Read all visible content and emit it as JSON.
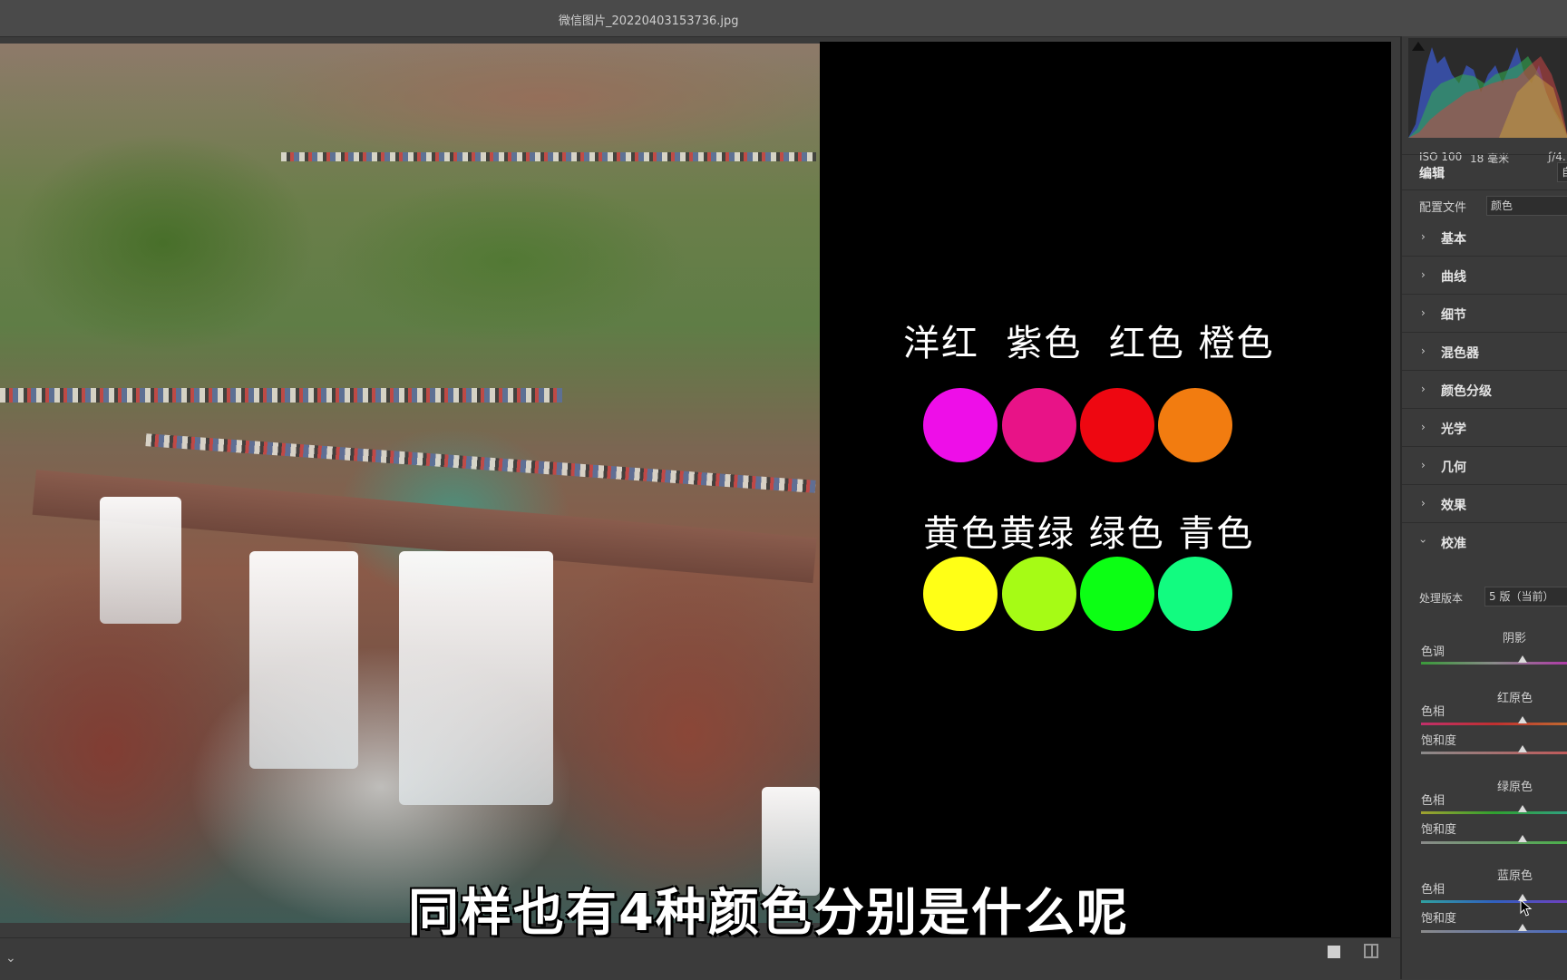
{
  "window": {
    "filename": "微信图片_20220403153736.jpg"
  },
  "slide": {
    "row1_label": "洋红  紫色  红色 橙色",
    "row1_colors": [
      "#ee0ee8",
      "#e81387",
      "#ee0711",
      "#f27c10"
    ],
    "row2_label": "黄色黄绿 绿色 青色",
    "row2_colors": [
      "#ffff16",
      "#a6fb15",
      "#0cff14",
      "#12fb80"
    ]
  },
  "subtitle": "同样也有4种颜色分别是什么呢",
  "panel": {
    "meta": {
      "iso": "ISO 100",
      "focal": "18 毫米",
      "aperture": "ƒ/4."
    },
    "edit_title": "编辑",
    "profile": {
      "label": "配置文件",
      "value": "颜色"
    },
    "sections": [
      "基本",
      "曲线",
      "细节",
      "混色器",
      "颜色分级",
      "光学",
      "几何",
      "效果"
    ],
    "calibration": {
      "title": "校准",
      "process_label": "处理版本",
      "process_value": "5 版（当前）",
      "shadows": {
        "head": "阴影",
        "label": "色调"
      },
      "red": {
        "head": "红原色",
        "hue": "色相",
        "sat": "饱和度"
      },
      "green": {
        "head": "绿原色",
        "hue": "色相",
        "sat": "饱和度"
      },
      "blue": {
        "head": "蓝原色",
        "hue": "色相",
        "sat": "饱和度"
      }
    }
  },
  "icons": {
    "histogram_warning": "clipping-warning-icon",
    "cursor": "mouse-cursor-icon",
    "single_view": "single-view-icon",
    "compare_view": "compare-view-icon",
    "filmstrip_toggle": "chevron-down-icon"
  }
}
